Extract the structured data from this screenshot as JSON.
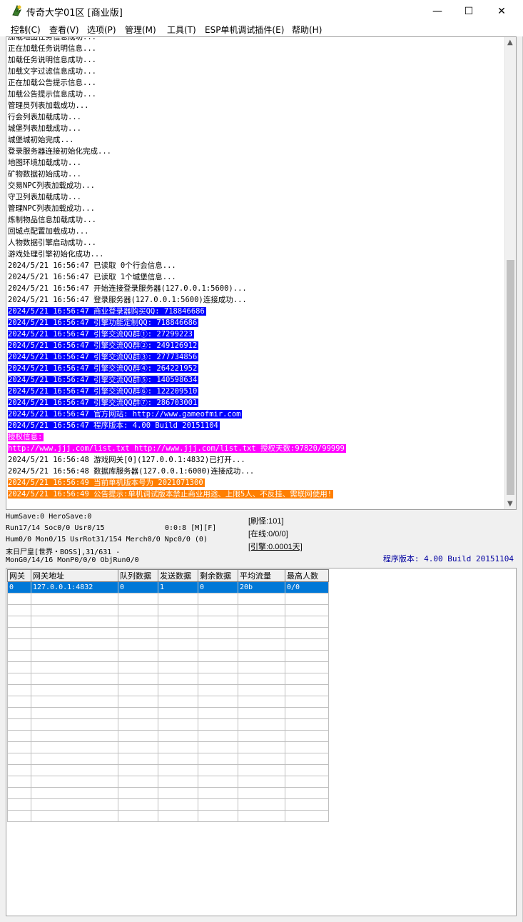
{
  "window": {
    "title": "传奇大学01区 [商业版]",
    "minimize": "—",
    "maximize": "☐",
    "close": "✕",
    "icon": "app-icon"
  },
  "menu": [
    "控制(C)",
    "查看(V)",
    "选项(P)",
    "管理(M)",
    "工具(T)",
    "ESP单机调试插件(E)",
    "帮助(H)"
  ],
  "log": [
    {
      "text": "加载地图任务信息成功...",
      "style": "normal"
    },
    {
      "text": "正在加载任务说明信息...",
      "style": "normal"
    },
    {
      "text": "加载任务说明信息成功...",
      "style": "normal"
    },
    {
      "text": "加载文字过滤信息成功...",
      "style": "normal"
    },
    {
      "text": "正在加载公告提示信息...",
      "style": "normal"
    },
    {
      "text": "加载公告提示信息成功...",
      "style": "normal"
    },
    {
      "text": "管理员列表加载成功...",
      "style": "normal"
    },
    {
      "text": "行会列表加载成功...",
      "style": "normal"
    },
    {
      "text": "城堡列表加载成功...",
      "style": "normal"
    },
    {
      "text": "城堡城初始完成...",
      "style": "normal"
    },
    {
      "text": "登录服务器连接初始化完成...",
      "style": "normal"
    },
    {
      "text": "地图环境加载成功...",
      "style": "normal"
    },
    {
      "text": "矿物数据初始成功...",
      "style": "normal"
    },
    {
      "text": "交易NPC列表加载成功...",
      "style": "normal"
    },
    {
      "text": "守卫列表加载成功...",
      "style": "normal"
    },
    {
      "text": "管理NPC列表加载成功...",
      "style": "normal"
    },
    {
      "text": "炼制物品信息加载成功...",
      "style": "normal"
    },
    {
      "text": "回城点配置加载成功...",
      "style": "normal"
    },
    {
      "text": "人物数据引擎启动成功...",
      "style": "normal"
    },
    {
      "text": "游戏处理引擎初始化成功...",
      "style": "normal"
    },
    {
      "text": "2024/5/21 16:56:47 已读取 0个行会信息...",
      "style": "normal"
    },
    {
      "text": "2024/5/21 16:56:47 已读取 1个城堡信息...",
      "style": "normal"
    },
    {
      "text": "2024/5/21 16:56:47 开始连接登录服务器(127.0.0.1:5600)...",
      "style": "normal"
    },
    {
      "text": "2024/5/21 16:56:47 登录服务器(127.0.0.1:5600)连接成功...",
      "style": "normal"
    },
    {
      "text": "2024/5/21 16:56:47 商业登录器购买QQ: 718846686",
      "style": "blue"
    },
    {
      "text": "2024/5/21 16:56:47 引擎功能定制QQ: 718846686",
      "style": "blue"
    },
    {
      "text": "2024/5/21 16:56:47 引擎交流QQ群①: 27299223",
      "style": "blue"
    },
    {
      "text": "2024/5/21 16:56:47 引擎交流QQ群②: 249126912",
      "style": "blue"
    },
    {
      "text": "2024/5/21 16:56:47 引擎交流QQ群③: 277734856",
      "style": "blue"
    },
    {
      "text": "2024/5/21 16:56:47 引擎交流QQ群④: 264221952",
      "style": "blue"
    },
    {
      "text": "2024/5/21 16:56:47 引擎交流QQ群⑤: 140598634",
      "style": "blue"
    },
    {
      "text": "2024/5/21 16:56:47 引擎交流QQ群⑥: 122209510",
      "style": "blue"
    },
    {
      "text": "2024/5/21 16:56:47 引擎交流QQ群⑦: 286703001",
      "style": "blue"
    },
    {
      "text": "2024/5/21 16:56:47 官方网站: http://www.gameofmir.com",
      "style": "blue"
    },
    {
      "text": "2024/5/21 16:56:47 程序版本: 4.00 Build 20151104",
      "style": "blue"
    },
    {
      "text": "授权信息:",
      "style": "magenta"
    },
    {
      "text": "http://www.jjj.com/list.txt http://www.jjj.com/list.txt 授权天数:97820/99999",
      "style": "magenta"
    },
    {
      "text": "2024/5/21 16:56:48 游戏网关[0](127.0.0.1:4832)已打开...",
      "style": "normal"
    },
    {
      "text": "2024/5/21 16:56:48 数据库服务器(127.0.0.1:6000)连接成功...",
      "style": "normal"
    },
    {
      "text": "2024/5/21 16:56:49 当前单机版本号为 2021071300",
      "style": "orange"
    },
    {
      "text": "2024/5/21 16:56:49 公告提示:单机调试版本禁止商业用途、上限5人、不反挂、需联网使用!",
      "style": "orange"
    }
  ],
  "status": {
    "line1": "HumSave:0 HeroSave:0",
    "line2": "Run17/14 Soc0/0 Usr0/15",
    "line2b": "0:0:8 [M][F]",
    "line3": "Hum0/0 Mon0/15 UsrRot31/154 Merch0/0 Npc0/0 (0)",
    "line4": "末日尸皇[世界・BOSS],31/631 -",
    "line5": "MonG0/14/16 MonP0/0/0 ObjRun0/0",
    "refresh": "[刷怪:101]",
    "online": "[在线:0/0/0]",
    "engine": "[引擎:0.0001天]",
    "version": "程序版本: 4.00 Build 20151104"
  },
  "grid": {
    "headers": [
      "网关",
      "网关地址",
      "队列数据",
      "发送数据",
      "剩余数据",
      "平均流量",
      "最高人数"
    ],
    "rows": [
      [
        "0",
        "127.0.0.1:4832",
        "0",
        "1",
        "0",
        "20b",
        "0/0"
      ]
    ],
    "empty_rows": 20
  }
}
